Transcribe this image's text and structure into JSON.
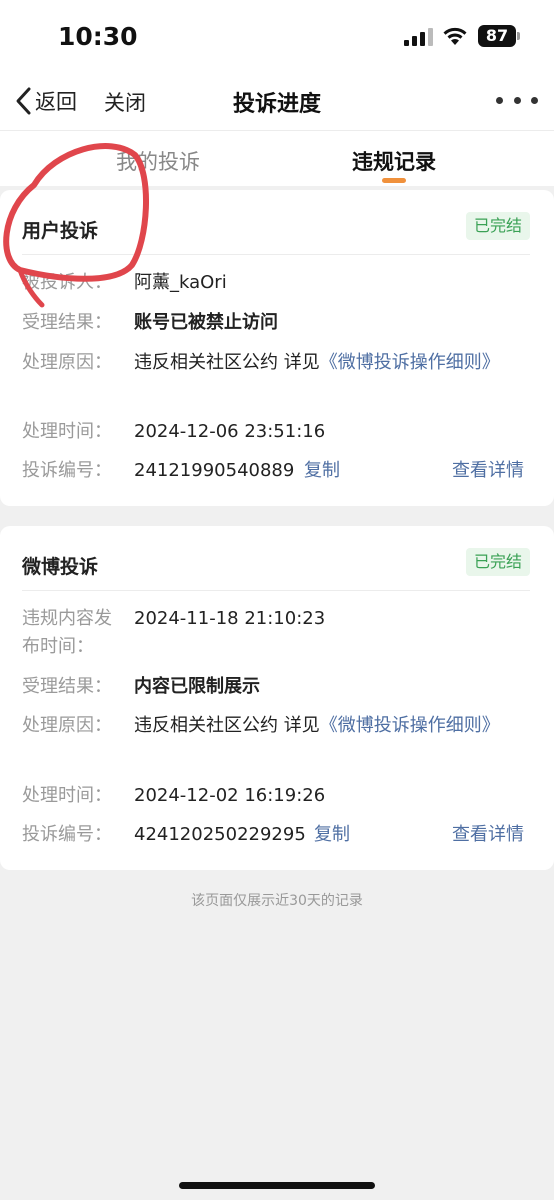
{
  "status_bar": {
    "time": "10:30",
    "battery": "87",
    "icons": [
      "signal-icon",
      "wifi-icon",
      "battery-icon"
    ]
  },
  "nav": {
    "back_label": "返回",
    "close_label": "关闭",
    "title": "投诉进度",
    "more_icon": "more-dots-icon"
  },
  "tabs": [
    {
      "label": "我的投诉",
      "active": false
    },
    {
      "label": "违规记录",
      "active": true
    }
  ],
  "colors": {
    "accent": "#f0913c",
    "link": "#4f6fa3",
    "status_green": "#3aa155",
    "annotation_red": "#e0464c"
  },
  "cards": [
    {
      "title": "用户投诉",
      "status": "已完结",
      "rows": [
        {
          "label": "被投诉人：",
          "value": "阿薰_kaOri"
        },
        {
          "label": "受理结果：",
          "value": "账号已被禁止访问"
        },
        {
          "label": "处理原因：",
          "value": "违反相关社区公约 详见",
          "link": "《微博投诉操作细则》"
        },
        {
          "label": "处理时间：",
          "value": "2024-12-06 23:51:16"
        },
        {
          "label": "投诉编号：",
          "value": "24121990540889",
          "copy": "复制",
          "detail": "查看详情"
        }
      ]
    },
    {
      "title": "微博投诉",
      "status": "已完结",
      "rows": [
        {
          "label": "违规内容发布时间：",
          "value": "2024-11-18 21:10:23"
        },
        {
          "label": "受理结果：",
          "value": "内容已限制展示"
        },
        {
          "label": "处理原因：",
          "value": "违反相关社区公约 详见",
          "link": "《微博投诉操作细则》"
        },
        {
          "label": "处理时间：",
          "value": "2024-12-02 16:19:26"
        },
        {
          "label": "投诉编号：",
          "value": "424120250229295",
          "copy": "复制",
          "detail": "查看详情"
        }
      ]
    }
  ],
  "footer_note": "该页面仅展示近30天的记录"
}
